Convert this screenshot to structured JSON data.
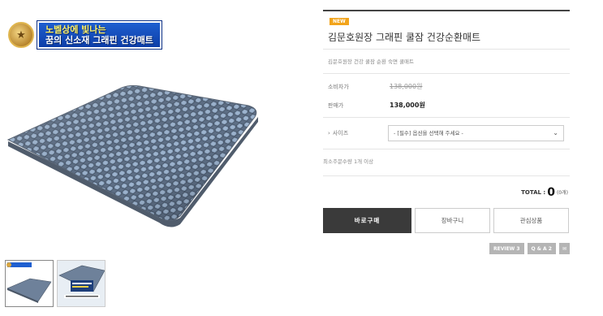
{
  "banner": {
    "line1": "노벨상에 빛나는",
    "line2": "꿈의 신소재 그래핀 건강매트",
    "medal_icon": "medal-icon"
  },
  "thumbnails": [
    {
      "label": "thumbnail-1",
      "active": true
    },
    {
      "label": "thumbnail-2",
      "active": false
    }
  ],
  "product": {
    "badge": "NEW",
    "title": "김문호원장 그래핀 쿨잠 건강순환매트",
    "subtitle": "김문호원장 건강 쿨잠 순환 숙면 쿨매트",
    "consumer_price_label": "소비자가",
    "consumer_price": "138,000원",
    "sale_price_label": "판매가",
    "sale_price": "138,000원",
    "option_arrow": "›",
    "option_label": "사이즈",
    "option_select": "- [필수] 옵션을 선택해 주세요 -",
    "min_order": "최소주문수량 1개 이상"
  },
  "total": {
    "label": "TOTAL :",
    "qty": "0",
    "count": "(0개)"
  },
  "actions": {
    "buy": "바로구매",
    "cart": "장바구니",
    "wish": "관심상품"
  },
  "tabs": {
    "review": "REVIEW 3",
    "qna": "Q & A 2",
    "mail_icon": "✉"
  },
  "colors": {
    "accent_new": "#f2a41b",
    "buy_button": "#3a3a3a",
    "banner_blue": "#1e5fd0"
  }
}
